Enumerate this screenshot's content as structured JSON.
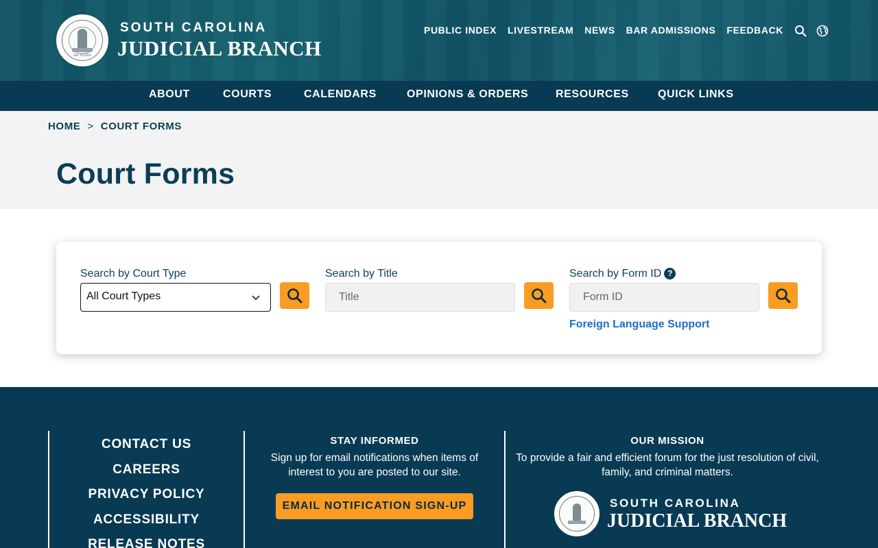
{
  "header": {
    "brand_top": "SOUTH CAROLINA",
    "brand_main": "JUDICIAL BRANCH",
    "seal_motto": "NIL ULTRA",
    "utility_links": [
      "PUBLIC INDEX",
      "LIVESTREAM",
      "NEWS",
      "BAR ADMISSIONS",
      "FEEDBACK"
    ],
    "icons": [
      "search-icon",
      "globe-icon"
    ]
  },
  "mainnav": {
    "items": [
      "ABOUT",
      "COURTS",
      "CALENDARS",
      "OPINIONS & ORDERS",
      "RESOURCES",
      "QUICK LINKS"
    ]
  },
  "breadcrumb": {
    "home": "HOME",
    "separator": ">",
    "current": "COURT FORMS"
  },
  "page": {
    "title": "Court Forms"
  },
  "search": {
    "court_type_label": "Search by Court Type",
    "court_type_value": "All Court Types",
    "title_label": "Search by Title",
    "title_placeholder": "Title",
    "form_id_label": "Search by Form ID",
    "form_id_placeholder": "Form ID",
    "help_glyph": "?",
    "foreign_language_link": "Foreign Language Support"
  },
  "footer": {
    "links": [
      "CONTACT US",
      "CAREERS",
      "PRIVACY POLICY",
      "ACCESSIBILITY",
      "RELEASE NOTES"
    ],
    "stay_informed_title": "STAY INFORMED",
    "stay_informed_text": "Sign up for email notifications when items of interest to you are posted to our site.",
    "signup_button": "EMAIL NOTIFICATION SIGN-UP",
    "mission_title": "OUR MISSION",
    "mission_text": "To provide a fair and efficient forum for the just resolution of civil, family, and criminal matters.",
    "brand_top": "SOUTH CAROLINA",
    "brand_main": "JUDICIAL BRANCH"
  },
  "colors": {
    "header_teal": "#0f5264",
    "nav_navy": "#083a54",
    "accent_orange": "#f89c23",
    "link_blue": "#1a6fc9"
  }
}
